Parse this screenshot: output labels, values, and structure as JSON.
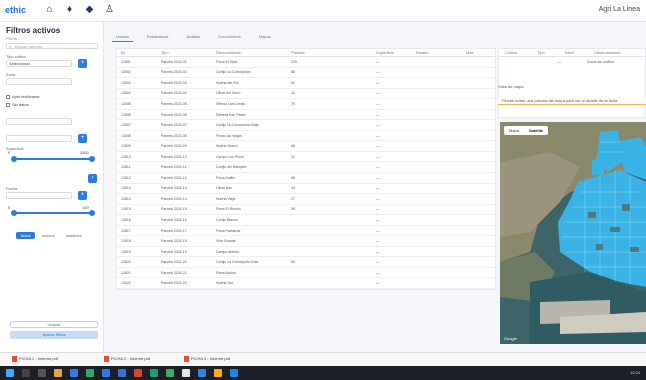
{
  "app": {
    "logo": "ethic",
    "name": "Agri La Linea"
  },
  "topbar": {
    "icons": [
      "home-icon",
      "pin-icon",
      "shield-icon",
      "user-icon"
    ]
  },
  "sidebar": {
    "title": "Filtros activos",
    "subtitle": "Filtros",
    "search_placeholder": "Buscar parcela",
    "fields": [
      {
        "label": "Tipo cultivo",
        "value": "Seleccionar"
      },
      {
        "label": "Zona",
        "value": ""
      }
    ],
    "checks": [
      "Apto fertilizante",
      "Sin datos"
    ],
    "range_label": "Superficie",
    "range_min": "0",
    "range_max": "2500",
    "range2_label": "Fecha",
    "range2_min": "0",
    "range2_max": "100",
    "pills": [
      "Todos",
      "Activos",
      "Inactivos"
    ],
    "btn_clear": "Limpiar",
    "btn_apply": "Aplicar filtros"
  },
  "tabs": [
    "Listado",
    "Estadísticas",
    "Análisis",
    "Documentos",
    "Mapas"
  ],
  "table": {
    "columns": [
      "ID",
      "Tipo",
      "Denominación",
      "Parcela",
      "Superficie",
      "Estado",
      "Más"
    ],
    "rows": [
      [
        "12601",
        "Parcela 2024-01",
        "Finca El Tejar",
        "120",
        "—",
        "",
        ""
      ],
      [
        "12602",
        "Parcela 2024-02",
        "Cortijo La Concepción",
        "88",
        "—",
        "",
        ""
      ],
      [
        "12603",
        "Parcela 2024-03",
        "Huerta del Río",
        "52",
        "—",
        "",
        ""
      ],
      [
        "12604",
        "Parcela 2024-04",
        "Olivar del Cerro",
        "40",
        "—",
        "",
        ""
      ],
      [
        "12605",
        "Parcela 2024-05",
        "Viñedo Las Lomas",
        "75",
        "—",
        "",
        ""
      ],
      [
        "12606",
        "Parcela 2024-06",
        "Dehesa San Pedro",
        "",
        "—",
        "",
        ""
      ],
      [
        "12607",
        "Parcela 2024-07",
        "Cortijo La Concepción Baja",
        "",
        "—",
        "",
        ""
      ],
      [
        "12608",
        "Parcela 2024-08",
        "Finca Las Vegas",
        "",
        "—",
        "",
        ""
      ],
      [
        "12609",
        "Parcela 2024-09",
        "Huerto Nuevo",
        "66",
        "—",
        "",
        ""
      ],
      [
        "12610",
        "Parcela 2024-10",
        "Campo Los Pinos",
        "31",
        "—",
        "",
        ""
      ],
      [
        "12611",
        "Parcela 2024-11",
        "Cortijo del Marqués",
        "",
        "—",
        "",
        ""
      ],
      [
        "12612",
        "Parcela 2024-12",
        "Finca Sotillo",
        "58",
        "—",
        "",
        ""
      ],
      [
        "12613",
        "Parcela 2024-13",
        "Olivar Alto",
        "44",
        "—",
        "",
        ""
      ],
      [
        "12614",
        "Parcela 2024-14",
        "Huerta Vieja",
        "27",
        "—",
        "",
        ""
      ],
      [
        "12615",
        "Parcela 2024-15",
        "Finca El Rincón",
        "39",
        "—",
        "",
        ""
      ],
      [
        "12616",
        "Parcela 2024-16",
        "Cortijo Blanco",
        "",
        "—",
        "",
        ""
      ],
      [
        "12617",
        "Parcela 2024-17",
        "Finca Palmeras",
        "",
        "—",
        "",
        ""
      ],
      [
        "12618",
        "Parcela 2024-18",
        "Viña Grande",
        "",
        "—",
        "",
        ""
      ],
      [
        "12619",
        "Parcela 2024-19",
        "Campo Abierto",
        "",
        "—",
        "",
        ""
      ],
      [
        "12620",
        "Parcela 2024-20",
        "Cortijo La Concepción Este",
        "50",
        "—",
        "",
        ""
      ],
      [
        "12621",
        "Parcela 2024-21",
        "Finca Molino",
        "",
        "—",
        "",
        ""
      ],
      [
        "12622",
        "Parcela 2024-22",
        "Huerta Sur",
        "",
        "—",
        "",
        ""
      ]
    ]
  },
  "rightpanel": {
    "columns": [
      "Cultivo",
      "Tipo",
      "Nivel",
      "Observaciones"
    ],
    "row": [
      "",
      "",
      "—",
      "Zona de cultivo"
    ],
    "section_title": "Vista de mapa",
    "banner": "Pinche sobre una parcela del mapa para ver el detalle de la ficha"
  },
  "map": {
    "toggle": [
      "Mapa",
      "Satélite"
    ],
    "credit": "Google"
  },
  "statusbar": {
    "files": [
      "FICHA 1 - Informe.pdf",
      "FICHA 2 - Informe.pdf",
      "FICHA 3 - Informe.pdf"
    ]
  },
  "taskbar": {
    "time": "10:24"
  }
}
